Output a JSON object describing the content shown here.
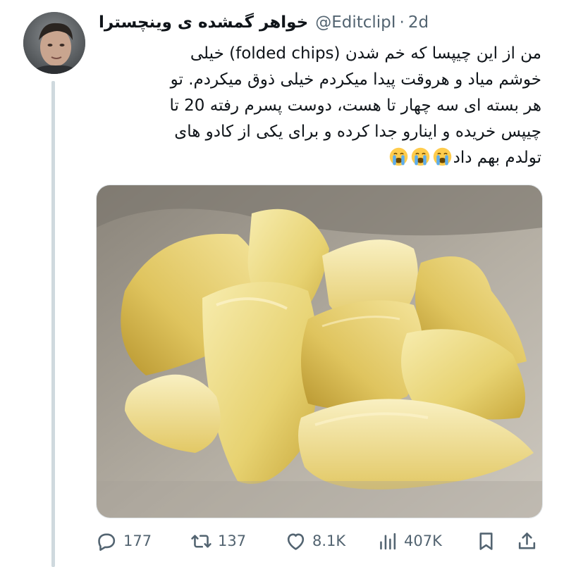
{
  "tweet": {
    "display_name": "خواهر گمشده ی وینچسترا",
    "handle": "@EditclipI",
    "separator": "·",
    "time": "2d",
    "text_lines": [
      "من از این چیپسا که خم شدن (folded chips) خیلی",
      "خوشم میاد و هروقت پیدا میکردم خیلی ذوق میکردم. تو",
      "هر بسته ای سه چهار تا هست، دوست پسرم رفته 20 تا",
      "چیپس خریده و اینارو جدا کرده و برای یکی از کادو های",
      "تولدم بهم داد"
    ],
    "emoji_name": "loudly-crying-face",
    "emoji_count": 3,
    "media_description": "photo"
  },
  "actions": {
    "replies": "177",
    "retweets": "137",
    "likes": "8.1K",
    "views": "407K"
  },
  "icons": {
    "reply": "reply-icon",
    "retweet": "retweet-icon",
    "like": "like-icon",
    "views": "views-icon",
    "bookmark": "bookmark-icon",
    "share": "share-icon"
  },
  "colors": {
    "text": "#0f1419",
    "secondary": "#536471",
    "thread_line": "#cfd9de"
  }
}
